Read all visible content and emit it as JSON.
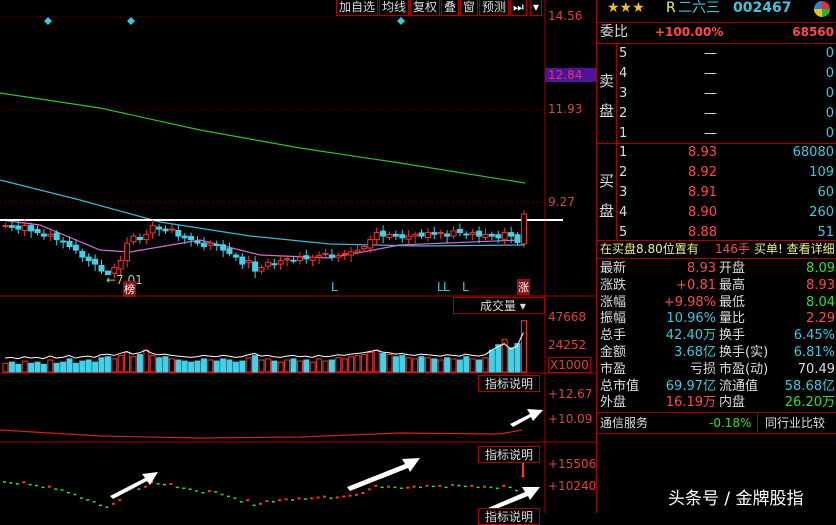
{
  "toolbar": {
    "buttons": [
      "加自选",
      "均线",
      "复权",
      "叠",
      "窗",
      "预测"
    ],
    "next_icon": "⏭",
    "dropdown_icon": "▾"
  },
  "price_axis": {
    "top": "14.56",
    "current": "12.84",
    "mid": "11.93",
    "low": "9.27"
  },
  "price_chart": {
    "low_label": "←7.01",
    "badge_bang": "榜",
    "badge_zhang": "涨",
    "markers": [
      "L",
      "L",
      "L",
      "L"
    ],
    "closes": [
      8.6,
      8.55,
      8.5,
      8.6,
      8.45,
      8.4,
      8.3,
      8.35,
      8.2,
      8.15,
      8.0,
      7.9,
      7.7,
      7.6,
      7.5,
      7.3,
      7.2,
      7.4,
      7.6,
      8.1,
      8.3,
      8.2,
      8.35,
      8.6,
      8.5,
      8.45,
      8.5,
      8.3,
      8.25,
      8.2,
      8.1,
      8.0,
      8.1,
      8.05,
      7.9,
      7.8,
      7.7,
      7.5,
      7.6,
      7.3,
      7.4,
      7.55,
      7.5,
      7.6,
      7.65,
      7.6,
      7.7,
      7.65,
      7.7,
      7.75,
      7.8,
      7.7,
      7.75,
      7.8,
      7.85,
      7.9,
      8.0,
      8.2,
      8.4,
      8.3,
      8.35,
      8.3,
      8.25,
      8.3,
      8.35,
      8.3,
      8.4,
      8.35,
      8.4,
      8.3,
      8.45,
      8.4,
      8.35,
      8.4,
      8.3,
      8.35,
      8.3,
      8.25,
      8.4,
      8.3,
      8.12,
      8.93
    ]
  },
  "volume": {
    "selector": "成交量",
    "axis": [
      "47668",
      "24252",
      "X1000"
    ],
    "values": [
      8,
      9,
      7,
      10,
      8,
      9,
      7,
      11,
      8,
      9,
      12,
      8,
      10,
      11,
      9,
      13,
      14,
      12,
      15,
      18,
      14,
      16,
      20,
      15,
      13,
      14,
      12,
      11,
      10,
      9,
      10,
      12,
      11,
      10,
      12,
      11,
      9,
      10,
      13,
      15,
      11,
      12,
      10,
      9,
      11,
      12,
      10,
      11,
      9,
      12,
      10,
      11,
      13,
      12,
      14,
      15,
      16,
      18,
      20,
      17,
      16,
      14,
      15,
      13,
      12,
      14,
      13,
      12,
      11,
      13,
      12,
      11,
      14,
      12,
      11,
      13,
      20,
      25,
      30,
      22,
      26,
      47
    ]
  },
  "indicator1": {
    "button": "指标说明",
    "axis": [
      "+12.67",
      "+10.09"
    ]
  },
  "indicator2": {
    "button": "指标说明",
    "axis": [
      "+15506",
      "+10240"
    ]
  },
  "indicator3": {
    "button": "指标说明"
  },
  "quote": {
    "stars": "★★★",
    "r_mark": "R",
    "name": "二六三",
    "code": "002467",
    "weibi_label": "委比",
    "weibi_pct": "+100.00%",
    "weibi_val": "68560",
    "sell_label": [
      "卖",
      "盘"
    ],
    "buy_label": [
      "买",
      "盘"
    ],
    "sell": [
      {
        "lv": "5",
        "p": "—",
        "v": "0"
      },
      {
        "lv": "4",
        "p": "—",
        "v": "0"
      },
      {
        "lv": "3",
        "p": "—",
        "v": "0"
      },
      {
        "lv": "2",
        "p": "—",
        "v": "0"
      },
      {
        "lv": "1",
        "p": "—",
        "v": "0"
      }
    ],
    "buy": [
      {
        "lv": "1",
        "p": "8.93",
        "v": "68080"
      },
      {
        "lv": "2",
        "p": "8.92",
        "v": "109"
      },
      {
        "lv": "3",
        "p": "8.91",
        "v": "60"
      },
      {
        "lv": "4",
        "p": "8.90",
        "v": "260"
      },
      {
        "lv": "5",
        "p": "8.88",
        "v": "51"
      }
    ],
    "notice": "在买盘8.80位置有",
    "notice_qty": "146手",
    "notice_link": "买单! 查看详细",
    "stats": [
      [
        "最新",
        "8.93",
        "red",
        "开盘",
        "8.09",
        "gr"
      ],
      [
        "涨跌",
        "+0.81",
        "red",
        "最高",
        "8.93",
        "red"
      ],
      [
        "涨幅",
        "+9.98%",
        "red",
        "最低",
        "8.04",
        "gr"
      ],
      [
        "振幅",
        "10.96%",
        "cy",
        "量比",
        "2.29",
        "red"
      ],
      [
        "总手",
        "42.40万",
        "cy",
        "换手",
        "6.45%",
        "cy"
      ],
      [
        "金额",
        "3.68亿",
        "cy",
        "换手(实)",
        "6.81%",
        "cy"
      ],
      [
        "市盈",
        "亏损",
        "wh",
        "市盈(动)",
        "70.49",
        "wh"
      ],
      [
        "总市值",
        "69.97亿",
        "cy",
        "流通值",
        "58.68亿",
        "cy"
      ],
      [
        "外盘",
        "16.19万",
        "red",
        "内盘",
        "26.20万",
        "gr"
      ]
    ],
    "industry": "通信服务",
    "industry_pct": "-0.18%",
    "compare": "同行业比较"
  },
  "watermark": "头条号 / 金牌股指"
}
